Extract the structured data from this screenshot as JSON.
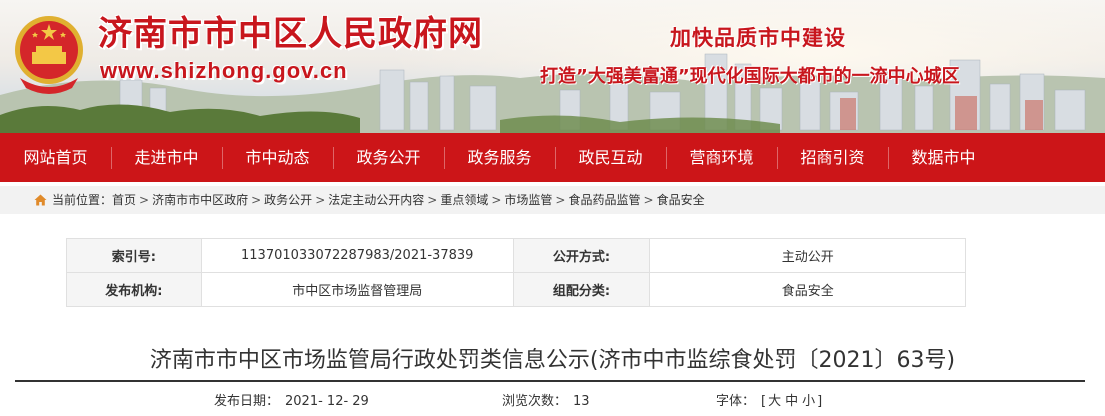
{
  "header": {
    "site_title": "济南市市中区人民政府网",
    "site_url": "www.shizhong.gov.cn",
    "slogan_main": "加快品质市中建设",
    "slogan_sub": "打造”大强美富通”现代化国际大都市的一流中心城区"
  },
  "nav": {
    "items": [
      "网站首页",
      "走进市中",
      "市中动态",
      "政务公开",
      "政务服务",
      "政民互动",
      "营商环境",
      "招商引资",
      "数据市中"
    ]
  },
  "breadcrumb": {
    "label": "当前位置：",
    "items": [
      "首页",
      "济南市市中区政府",
      "政务公开",
      "法定主动公开内容",
      "重点领域",
      "市场监管",
      "食品药品监管",
      "食品安全"
    ],
    "separator": ">"
  },
  "meta": {
    "index_label": "索引号:",
    "index_value": "113701033072287983/2021-37839",
    "open_label": "公开方式:",
    "open_value": "主动公开",
    "issuer_label": "发布机构:",
    "issuer_value": "市中区市场监督管理局",
    "category_label": "组配分类:",
    "category_value": "食品安全"
  },
  "article": {
    "title": "济南市市中区市场监管局行政处罚类信息公示(济市中市监综食处罚〔2021〕63号)",
    "date_label": "发布日期：",
    "date_value": "2021- 12- 29",
    "views_label": "浏览次数：",
    "views_value": "13",
    "fontsize_label": "字体：",
    "fontsize_open": "[",
    "fontsize_large": "大",
    "fontsize_medium": "中",
    "fontsize_small": "小",
    "fontsize_close": "]"
  },
  "colors": {
    "brand_red": "#cc1518",
    "title_red": "#c8161d"
  },
  "icons": {
    "home": "home-icon",
    "emblem": "national-emblem-icon"
  }
}
